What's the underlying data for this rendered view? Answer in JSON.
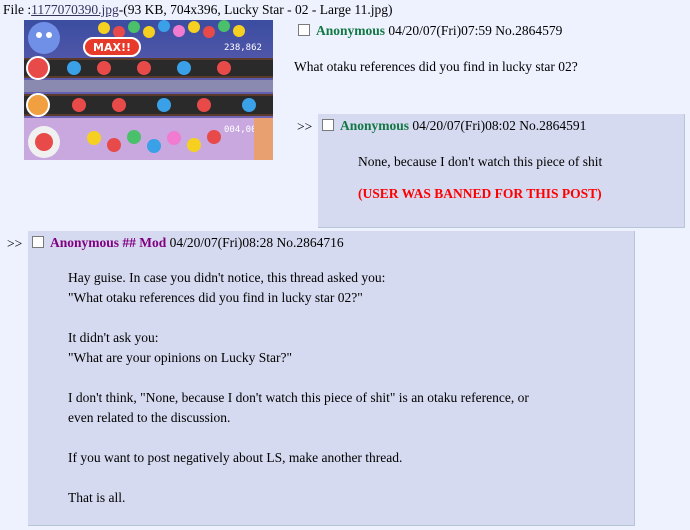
{
  "file": {
    "prefix": "File :",
    "filename": "1177070390.jpg",
    "meta": "-(93 KB, 704x396, Lucky Star - 02 - Large 11.jpg)"
  },
  "thumbnail": {
    "alt": "Taiko game screenshot",
    "badge_max": "MAX!!",
    "score_top": "238,862",
    "score_bottom": "004,008"
  },
  "op": {
    "name": "Anonymous",
    "datetime": "04/20/07(Fri)07:59",
    "postno": "No.2864579",
    "comment": "What otaku references did you find in lucky star 02?"
  },
  "reply1": {
    "quote_marker": ">>",
    "name": "Anonymous",
    "datetime": "04/20/07(Fri)08:02",
    "postno": "No.2864591",
    "comment": "None, because I don't watch this piece of shit",
    "ban_notice": "(USER WAS BANNED FOR THIS POST)"
  },
  "reply2": {
    "quote_marker": ">>",
    "name": "Anonymous",
    "capcode": "## Mod",
    "datetime": "04/20/07(Fri)08:28",
    "postno": "No.2864716",
    "lines": [
      "Hay guise. In case you didn't notice, this thread asked you:",
      "\"What otaku references did you find in lucky star 02?\"",
      "It didn't ask you:",
      "\"What are your opinions on Lucky Star?\"",
      "I don't think, \"None, because I don't watch this piece of shit\" is an otaku reference, or",
      "even related to the discussion.",
      "If you want to post negatively about LS, make another thread.",
      "That is all."
    ]
  },
  "colors": {
    "page_bg": "#eef2ff",
    "reply_bg": "#d6daf0",
    "name": "#117743",
    "mod_name": "#800080",
    "ban": "#ff0000"
  }
}
